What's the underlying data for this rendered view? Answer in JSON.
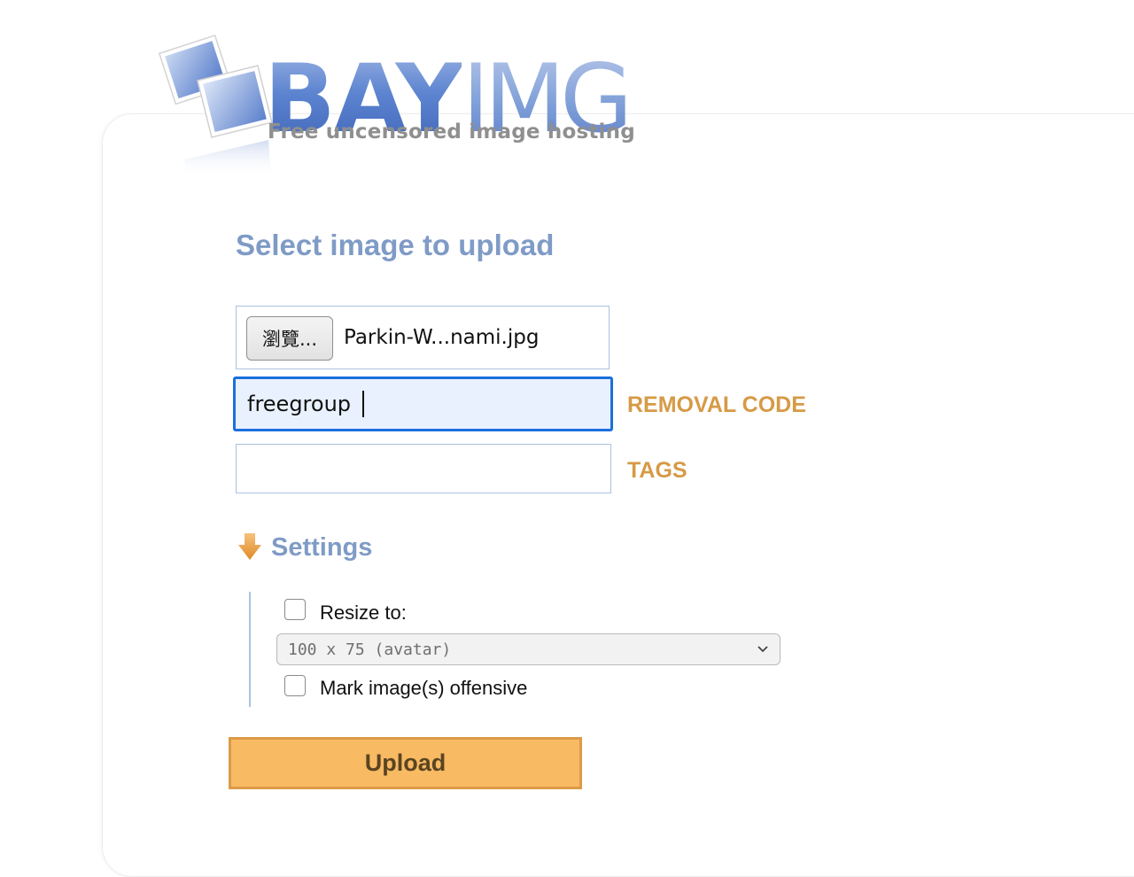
{
  "logo": {
    "bay": "BAY",
    "img": "IMG",
    "tagline": "Free uncensored image hosting"
  },
  "upload": {
    "title": "Select image to upload",
    "browse_label": "瀏覽...",
    "file_name": "Parkin-W...nami.jpg",
    "removal_code_value": "freegroup",
    "removal_code_label": "REMOVAL CODE",
    "tags_value": "",
    "tags_label": "TAGS"
  },
  "settings": {
    "title": "Settings",
    "resize_label": "Resize to:",
    "resize_checked": false,
    "resize_selected": "100 x 75 (avatar)",
    "offensive_label": "Mark image(s) offensive",
    "offensive_checked": false
  },
  "actions": {
    "upload_label": "Upload"
  },
  "colors": {
    "accent_blue": "#7f9bc6",
    "label_orange": "#d69a45",
    "button_orange": "#f8ba62",
    "focus_blue": "#1d6fdc"
  },
  "icons": [
    "bayimg-logo-photos",
    "arrow-down-icon",
    "chevron-down-icon"
  ]
}
